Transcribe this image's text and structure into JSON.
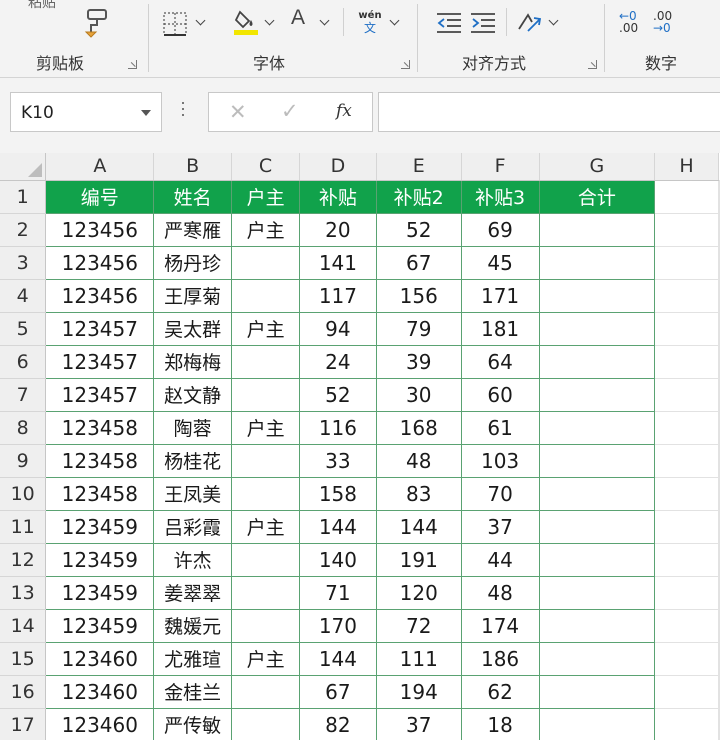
{
  "ribbon": {
    "clipboard": {
      "paste_label": "粘贴",
      "group_label": "剪贴板"
    },
    "font": {
      "font_color_glyph": "A",
      "font_size_glyph": "A",
      "phonetic_top": "wén",
      "phonetic_bottom": "文",
      "group_label": "字体"
    },
    "alignment": {
      "group_label": "对齐方式"
    },
    "number": {
      "inc_top": "←0",
      "inc_bottom": ".00",
      "dec_top": ".00",
      "dec_bottom": "→0",
      "group_label": "数字"
    },
    "colors": {
      "highlight": "#f2e600",
      "font_color": "#d92b2b"
    },
    "icons": [
      "format-painter-icon",
      "borders-icon",
      "fill-color-icon",
      "font-color-icon",
      "phonetic-guide-icon",
      "decrease-indent-icon",
      "increase-indent-icon",
      "orientation-icon",
      "increase-decimal-icon",
      "decrease-decimal-icon"
    ]
  },
  "formula_bar": {
    "name_box": "K10",
    "cancel_glyph": "✕",
    "enter_glyph": "✓",
    "fx_glyph": "fx",
    "formula": ""
  },
  "sheet": {
    "column_headers": [
      "A",
      "B",
      "C",
      "D",
      "E",
      "F",
      "G",
      "H"
    ],
    "row_headers": [
      "1",
      "2",
      "3",
      "4",
      "5",
      "6",
      "7",
      "8",
      "9",
      "10",
      "11",
      "12",
      "13",
      "14",
      "15",
      "16",
      "17"
    ],
    "header_fill": "#11a24b",
    "header_text_color": "#ffffff",
    "border_color": "#5aa272",
    "table_header": [
      "编号",
      "姓名",
      "户主",
      "补贴",
      "补贴2",
      "补贴3",
      "合计"
    ],
    "rows": [
      [
        "123456",
        "严寒雁",
        "户主",
        "20",
        "52",
        "69",
        ""
      ],
      [
        "123456",
        "杨丹珍",
        "",
        "141",
        "67",
        "45",
        ""
      ],
      [
        "123456",
        "王厚菊",
        "",
        "117",
        "156",
        "171",
        ""
      ],
      [
        "123457",
        "吴太群",
        "户主",
        "94",
        "79",
        "181",
        ""
      ],
      [
        "123457",
        "郑梅梅",
        "",
        "24",
        "39",
        "64",
        ""
      ],
      [
        "123457",
        "赵文静",
        "",
        "52",
        "30",
        "60",
        ""
      ],
      [
        "123458",
        "陶蓉",
        "户主",
        "116",
        "168",
        "61",
        ""
      ],
      [
        "123458",
        "杨桂花",
        "",
        "33",
        "48",
        "103",
        ""
      ],
      [
        "123458",
        "王凤美",
        "",
        "158",
        "83",
        "70",
        ""
      ],
      [
        "123459",
        "吕彩霞",
        "户主",
        "144",
        "144",
        "37",
        ""
      ],
      [
        "123459",
        "许杰",
        "",
        "140",
        "191",
        "44",
        ""
      ],
      [
        "123459",
        "姜翠翠",
        "",
        "71",
        "120",
        "48",
        ""
      ],
      [
        "123459",
        "魏媛元",
        "",
        "170",
        "72",
        "174",
        ""
      ],
      [
        "123460",
        "尤雅瑄",
        "户主",
        "144",
        "111",
        "186",
        ""
      ],
      [
        "123460",
        "金桂兰",
        "",
        "67",
        "194",
        "62",
        ""
      ],
      [
        "123460",
        "严传敏",
        "",
        "82",
        "37",
        "18",
        ""
      ]
    ]
  }
}
